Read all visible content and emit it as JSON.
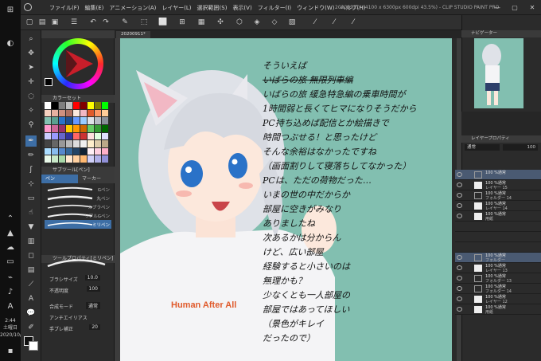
{
  "app": {
    "menus": [
      "ファイル(F)",
      "編集(E)",
      "アニメーション(A)",
      "レイヤー(L)",
      "選択範囲(S)",
      "表示(V)",
      "フィルター(I)",
      "ウィンドウ(W)",
      "ヘルプ(H)"
    ],
    "title": "20200911* (4100 x 6300px 600dpi 43.5%) - CLIP STUDIO PAINT PRO",
    "doc_tab": "20200911*"
  },
  "taskbar": {
    "time": "2:44",
    "day": "土曜日",
    "date": "2020/10/17"
  },
  "left_panels": {
    "color_set_title": "カラーセット",
    "sub_tool_title": "サブツール[ペン]",
    "subtabs": [
      "ペン",
      "マーカー"
    ],
    "brushes": [
      "Gペン",
      "丸ペン",
      "カブラペン",
      "リアルGペン",
      "ミリペン"
    ],
    "tool_property_title": "ツールプロパティ[ミリペン]",
    "props": [
      {
        "label": "ブラシサイズ",
        "value": "10.0"
      },
      {
        "label": "不透明度",
        "value": "100"
      },
      {
        "label": "合成モード",
        "value": "通常"
      },
      {
        "label": "アンチエイリアス",
        "value": ""
      },
      {
        "label": "手ブレ補正",
        "value": "20"
      }
    ]
  },
  "canvas": {
    "handwriting": [
      {
        "text": "そういえば",
        "strike": false
      },
      {
        "text": "いばらの旅 無限列車編",
        "strike": true
      },
      {
        "text": "いばらの旅 緩急特急編の乗車時間が",
        "strike": false
      },
      {
        "text": "1時間弱と長くてヒマになりそうだから",
        "strike": false
      },
      {
        "text": "PC持ち込めば配信とか絵描きで",
        "strike": false
      },
      {
        "text": "時間つぶせる！と思ったけど",
        "strike": false
      },
      {
        "text": "そんな余裕はなかったですね",
        "strike": false
      },
      {
        "text": "（画面割りして寝落ちしてなかった）",
        "strike": false
      },
      {
        "text": "PCは、ただの荷物だった…",
        "strike": false
      },
      {
        "text": "いまの世の中だからか",
        "strike": false
      },
      {
        "text": "部屋に空きがみなり",
        "strike": false
      },
      {
        "text": "ありましたね",
        "strike": false
      },
      {
        "text": "次あるかは分からん",
        "strike": false
      },
      {
        "text": "けど、広い部屋",
        "strike": false
      },
      {
        "text": "経験すると小さいのは",
        "strike": false
      },
      {
        "text": "無理かも？",
        "strike": false
      },
      {
        "text": "少なくとも一人部屋の",
        "strike": false
      },
      {
        "text": "部屋ではあってほしい",
        "strike": false
      },
      {
        "text": "（景色がキレイ",
        "strike": false
      },
      {
        "text": "だったので）",
        "strike": false
      }
    ],
    "shirt_text": "Human After All"
  },
  "right_panels": {
    "navigator_title": "ナビゲーター",
    "layer_title": "レイヤープロパティ",
    "blend": "通常",
    "opacity": "100",
    "layers": [
      {
        "line1": "100 %通常",
        "line2": "",
        "type": "fold",
        "selected": true
      },
      {
        "line1": "100 %通常",
        "line2": "レイヤー 15",
        "type": "img",
        "selected": false
      },
      {
        "line1": "100 %通常",
        "line2": "フォルダー 14",
        "type": "fold",
        "selected": false
      },
      {
        "line1": "100 %通常",
        "line2": "レイヤー 14",
        "type": "img",
        "selected": false
      },
      {
        "line1": "100 %通常",
        "line2": "用紙",
        "type": "img",
        "selected": false
      },
      {
        "line1": "",
        "line2": "",
        "type": "none",
        "selected": false
      },
      {
        "line1": "",
        "line2": "",
        "type": "none",
        "selected": false
      },
      {
        "line1": "",
        "line2": "",
        "type": "none",
        "selected": false
      },
      {
        "line1": "100 %通常",
        "line2": "フォルダー",
        "type": "fold",
        "selected": true
      },
      {
        "line1": "100 %通常",
        "line2": "レイヤー 13",
        "type": "img",
        "selected": false
      },
      {
        "line1": "100 %通常",
        "line2": "フォルダー 13",
        "type": "fold",
        "selected": false
      },
      {
        "line1": "100 %通常",
        "line2": "フォルダー 14",
        "type": "fold",
        "selected": false
      },
      {
        "line1": "100 %通常",
        "line2": "レイヤー 12",
        "type": "img",
        "selected": false
      },
      {
        "line1": "100 %通常",
        "line2": "用紙",
        "type": "img",
        "selected": false
      }
    ]
  }
}
